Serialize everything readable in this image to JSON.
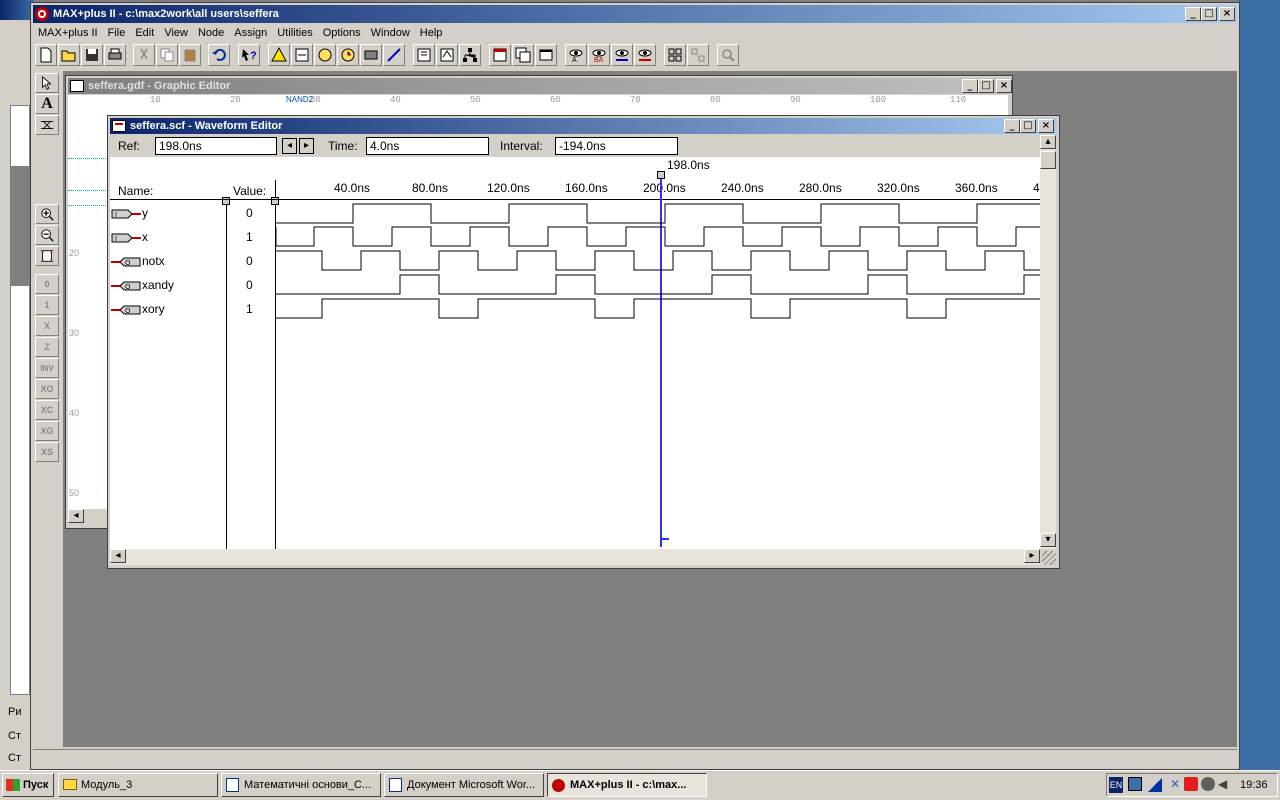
{
  "app": {
    "title": "MAX+plus II - c:\\max2work\\all users\\seffera"
  },
  "menu": [
    {
      "label": "MAX+plus II"
    },
    {
      "label": "File"
    },
    {
      "label": "Edit"
    },
    {
      "label": "View"
    },
    {
      "label": "Node"
    },
    {
      "label": "Assign"
    },
    {
      "label": "Utilities"
    },
    {
      "label": "Options"
    },
    {
      "label": "Window"
    },
    {
      "label": "Help"
    }
  ],
  "graphic_editor": {
    "title": "seffera.gdf - Graphic Editor",
    "ruler": [
      "10",
      "20",
      "30",
      "40",
      "50",
      "60",
      "70",
      "80",
      "90",
      "100",
      "110"
    ],
    "vruler": [
      "20",
      "30",
      "40",
      "50"
    ],
    "gate_label": "NAND2"
  },
  "waveform_editor": {
    "title": "seffera.scf - Waveform Editor",
    "ref_label": "Ref:",
    "ref_value": "198.0ns",
    "time_label": "Time:",
    "time_value": "4.0ns",
    "interval_label": "Interval:",
    "interval_value": "-194.0ns",
    "cursor_label": "198.0ns",
    "name_header": "Name:",
    "value_header": "Value:",
    "ticks": [
      "40.0ns",
      "80.0ns",
      "120.0ns",
      "160.0ns",
      "200.0ns",
      "240.0ns",
      "280.0ns",
      "320.0ns",
      "360.0ns",
      "4"
    ],
    "signals": [
      {
        "name": "y",
        "value": "0",
        "kind": "input"
      },
      {
        "name": "x",
        "value": "1",
        "kind": "input"
      },
      {
        "name": "notx",
        "value": "0",
        "kind": "output"
      },
      {
        "name": "xandy",
        "value": "0",
        "kind": "output"
      },
      {
        "name": "xory",
        "value": "1",
        "kind": "output"
      }
    ]
  },
  "left_toolbar": {
    "buttons": [
      "pointer",
      "text",
      "wire",
      "zoom-in",
      "zoom-out",
      "fit",
      "0",
      "1",
      "X",
      "Z",
      "INV",
      "XO",
      "XC",
      "XG",
      "XS"
    ]
  },
  "background_panel": {
    "items": [
      "Ри",
      "Ст",
      "Ст"
    ]
  },
  "taskbar": {
    "start": "Пуск",
    "tasks": [
      {
        "label": "Модуль_3"
      },
      {
        "label": "Математичні основи_С..."
      },
      {
        "label": "Документ Microsoft Wor..."
      },
      {
        "label": "MAX+plus II - c:\\max..."
      }
    ],
    "lang": "EN",
    "clock": "19:36"
  },
  "colors": {
    "title_active": "#0a246a",
    "cursor": "#3030ff",
    "pin_red": "#c00000",
    "desktop_blue": "#3a6ea5"
  }
}
